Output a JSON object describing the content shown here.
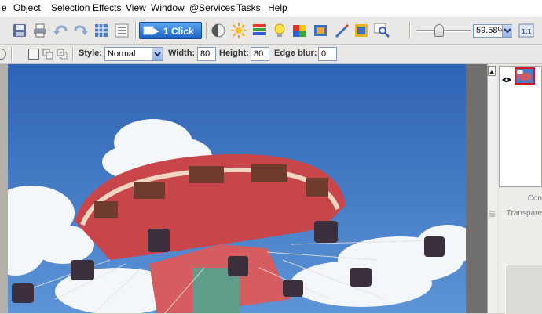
{
  "menubar": {
    "items": [
      "e",
      "Object",
      "Selection",
      "Effects",
      "View",
      "Window",
      "@Services",
      "Tasks",
      "Help"
    ]
  },
  "toolbar": {
    "one_click_label": "1 Click",
    "zoom_value": "59.58%",
    "zoom_level_fraction": 0.3
  },
  "options_bar": {
    "style_label": "Style:",
    "style_value": "Normal",
    "width_label": "Width:",
    "width_value": "80",
    "height_label": "Height:",
    "height_value": "80",
    "edge_blur_label": "Edge blur:",
    "edge_blur_value": "0"
  },
  "right_panel": {
    "prop_label_1": "Con",
    "prop_label_2": "Transpare"
  },
  "colors": {
    "accent": "#1c62c6",
    "sky": "#3f76c2",
    "layer_selection": "#d3141b"
  }
}
